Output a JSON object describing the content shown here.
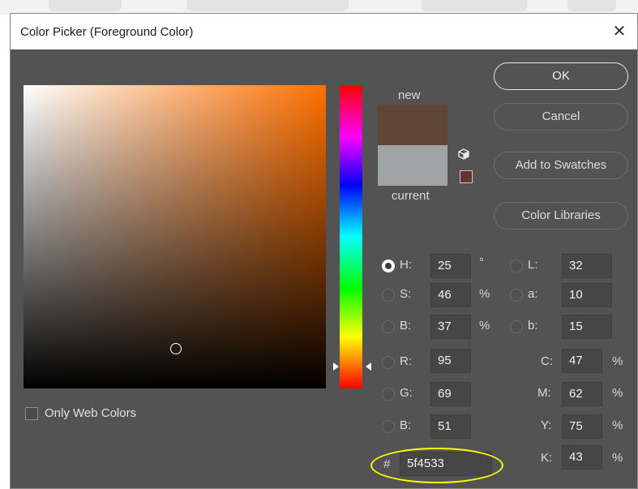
{
  "window": {
    "title": "Color Picker (Foreground Color)"
  },
  "preview": {
    "new_label": "new",
    "current_label": "current",
    "new_color": "#5f4533",
    "current_color": "#a0a3a4",
    "websafe_color": "#663333"
  },
  "buttons": {
    "ok": "OK",
    "cancel": "Cancel",
    "add_to_swatches": "Add to Swatches",
    "color_libraries": "Color Libraries"
  },
  "hsb": {
    "h": {
      "label": "H:",
      "value": "25",
      "unit": "°",
      "selected": true
    },
    "s": {
      "label": "S:",
      "value": "46",
      "unit": "%"
    },
    "b": {
      "label": "B:",
      "value": "37",
      "unit": "%"
    }
  },
  "rgb": {
    "r": {
      "label": "R:",
      "value": "95"
    },
    "g": {
      "label": "G:",
      "value": "69"
    },
    "b": {
      "label": "B:",
      "value": "51"
    }
  },
  "lab": {
    "l": {
      "label": "L:",
      "value": "32"
    },
    "a": {
      "label": "a:",
      "value": "10"
    },
    "b": {
      "label": "b:",
      "value": "15"
    }
  },
  "cmyk": {
    "c": {
      "label": "C:",
      "value": "47",
      "unit": "%"
    },
    "m": {
      "label": "M:",
      "value": "62",
      "unit": "%"
    },
    "y": {
      "label": "Y:",
      "value": "75",
      "unit": "%"
    },
    "k": {
      "label": "K:",
      "value": "43",
      "unit": "%"
    }
  },
  "hex": {
    "label": "#",
    "value": "5f4533"
  },
  "only_web_colors": {
    "label": "Only Web Colors",
    "checked": false
  },
  "icons": [
    "close-icon",
    "cube-icon",
    "radio-icon",
    "checkbox-icon"
  ],
  "colors": {
    "dialog_bg": "#535353",
    "hue_base": "#ff7000",
    "highlight": "#ffff00"
  }
}
